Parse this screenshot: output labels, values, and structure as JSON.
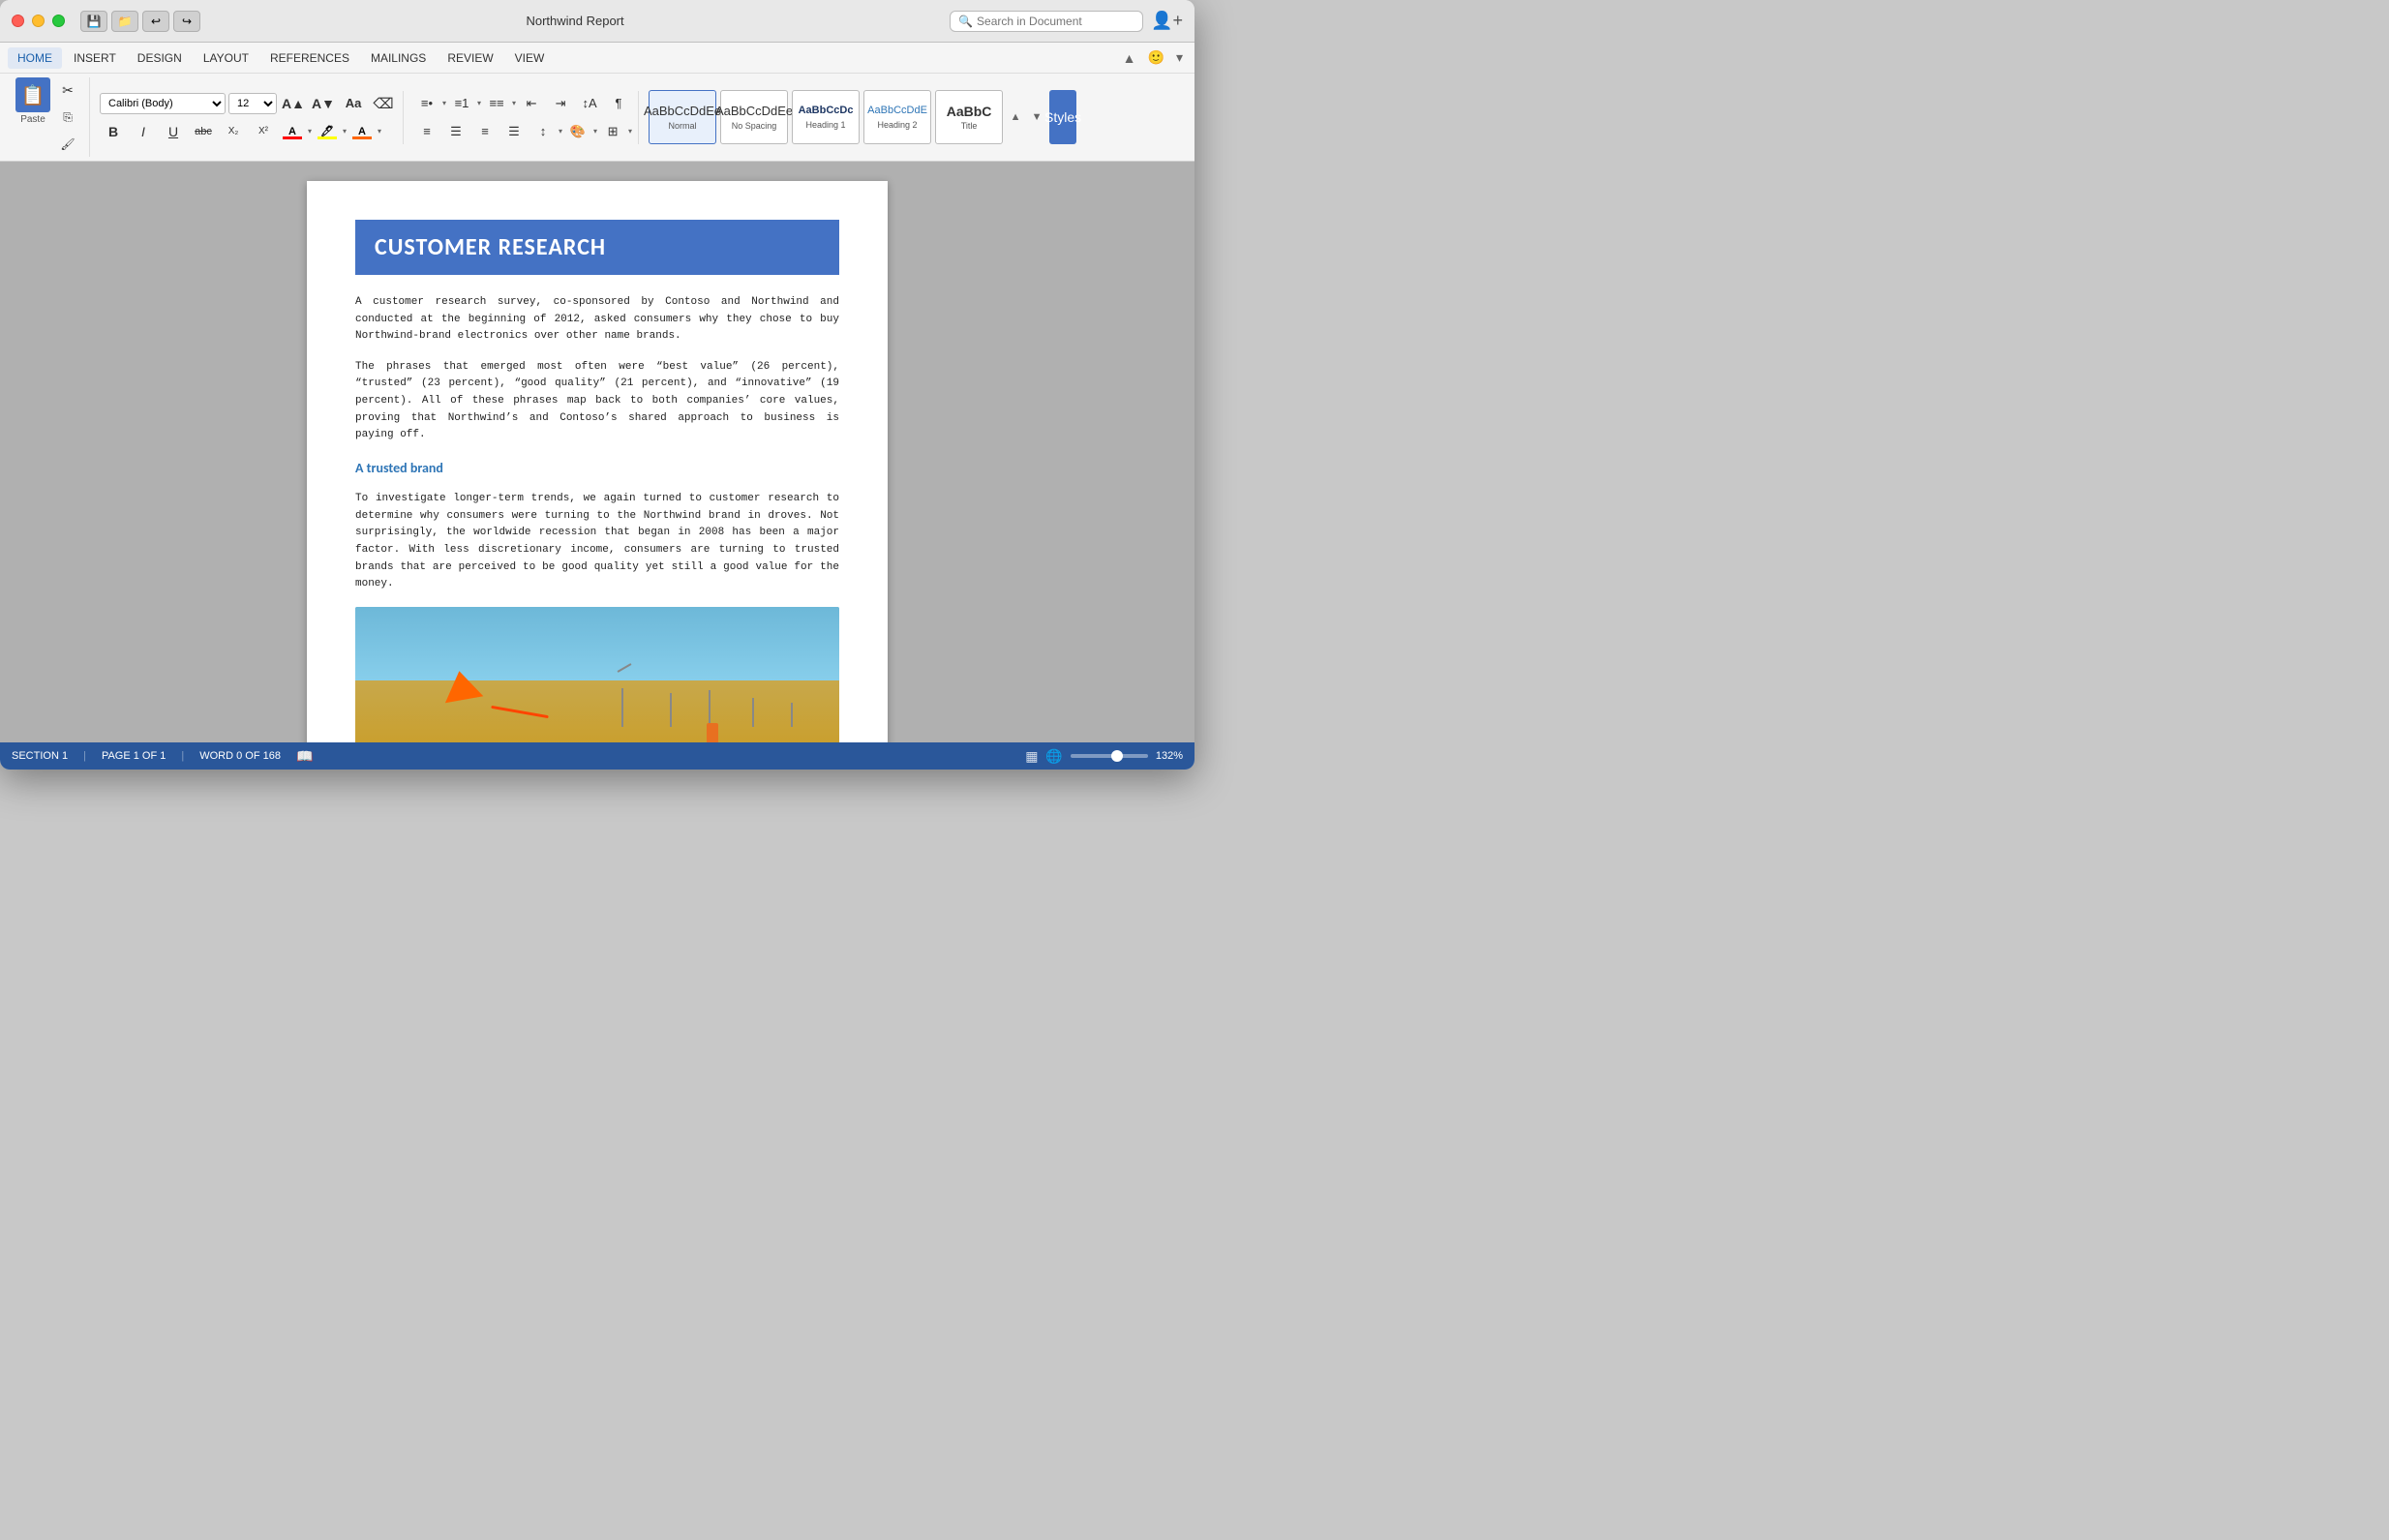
{
  "window": {
    "title": "Northwind Report"
  },
  "titlebar": {
    "save_btn": "💾",
    "folder_btn": "📁",
    "undo_btn": "↩",
    "redo_btn": "↪",
    "search_placeholder": "Search in Document",
    "user_icon": "👤"
  },
  "menu": {
    "items": [
      "HOME",
      "INSERT",
      "DESIGN",
      "LAYOUT",
      "REFERENCES",
      "MAILINGS",
      "REVIEW",
      "VIEW"
    ],
    "active": "HOME"
  },
  "toolbar": {
    "paste_label": "Paste",
    "font_name": "Calibri (Body)",
    "font_size": "12",
    "bold": "B",
    "italic": "I",
    "underline": "U",
    "strikethrough": "abc",
    "subscript": "X₂",
    "superscript": "X²"
  },
  "styles": {
    "items": [
      {
        "label": "Normal",
        "preview": "AaBbCcDdEe"
      },
      {
        "label": "No Spacing",
        "preview": "AaBbCcDdEe"
      },
      {
        "label": "Heading 1",
        "preview": "AaBbCcDc"
      },
      {
        "label": "Heading 2",
        "preview": "AaBbCcDdE"
      },
      {
        "label": "Title",
        "preview": "AaBbC"
      }
    ]
  },
  "document": {
    "title": "CUSTOMER RESEARCH",
    "para1": "A customer research survey, co-sponsored by Contoso and Northwind and conducted at the beginning of 2012, asked consumers why they chose to buy Northwind-brand electronics over other name brands.",
    "para2": "The phrases that emerged most often were “best value” (26 percent), “trusted” (23 percent), “good quality” (21 percent), and “innovative” (19 percent). All of these phrases map back to both companies’ core values, proving that Northwind’s and Contoso’s shared approach to business is paying off.",
    "section_heading": "A trusted brand",
    "para3": "To investigate longer-term trends, we again turned to customer research to determine why consumers were turning to the Northwind brand in droves. Not surprisingly, the worldwide recession that began in 2008 has been a major factor. With less discretionary income, consumers are turning to trusted brands that are perceived to be good quality yet still a good value for the money."
  },
  "status": {
    "section": "SECTION 1",
    "page": "PAGE 1 OF 1",
    "word_count": "WORD 0 OF 168",
    "zoom": "132%"
  }
}
